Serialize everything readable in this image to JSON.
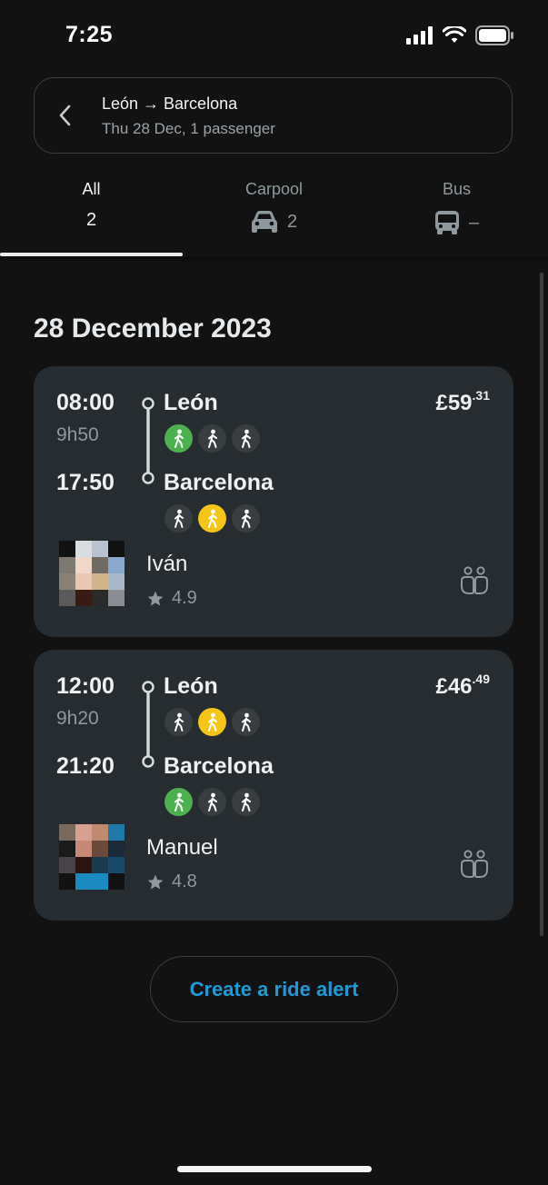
{
  "status_bar": {
    "time": "7:25"
  },
  "search": {
    "route": "León → Barcelona",
    "details": "Thu 28 Dec, 1 passenger"
  },
  "tabs": [
    {
      "label": "All",
      "count": "2",
      "icon": ""
    },
    {
      "label": "Carpool",
      "count": "2",
      "icon": "car-icon"
    },
    {
      "label": "Bus",
      "count": "–",
      "icon": "bus-icon"
    }
  ],
  "date_heading": "28 December 2023",
  "rides": [
    {
      "departure_time": "08:00",
      "duration": "9h50",
      "arrival_time": "17:50",
      "from_city": "León",
      "to_city": "Barcelona",
      "price_main": "£59",
      "price_cents": ".31",
      "driver_name": "Iván",
      "rating": "4.9",
      "from_walk": [
        "green",
        "grey",
        "grey"
      ],
      "to_walk": [
        "grey",
        "yellow",
        "grey"
      ]
    },
    {
      "departure_time": "12:00",
      "duration": "9h20",
      "arrival_time": "21:20",
      "from_city": "León",
      "to_city": "Barcelona",
      "price_main": "£46",
      "price_cents": ".49",
      "driver_name": "Manuel",
      "rating": "4.8",
      "from_walk": [
        "grey",
        "yellow",
        "grey"
      ],
      "to_walk": [
        "green",
        "grey",
        "grey"
      ]
    }
  ],
  "create_alert_label": "Create a ride alert",
  "colors": {
    "accent": "#1d9bd8",
    "card_bg": "#262c2f",
    "walk_near": "#4caf50",
    "walk_medium": "#f5c518"
  }
}
